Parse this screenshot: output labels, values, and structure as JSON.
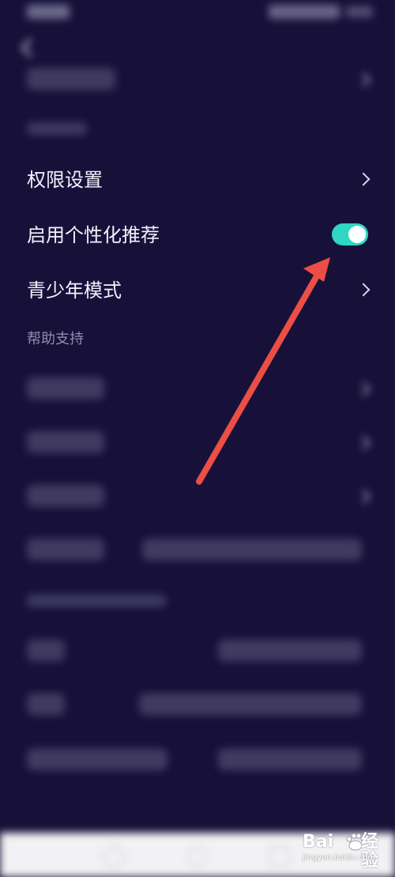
{
  "settings": {
    "privacy_items": [
      {
        "label": "权限设置"
      },
      {
        "label": "启用个性化推荐",
        "toggle_on": true
      },
      {
        "label": "青少年模式"
      }
    ],
    "help_section_title": "帮助支持"
  },
  "colors": {
    "background": "#17113a",
    "toggle_on": "#2fd6c4",
    "annotation_arrow": "#ec4e46",
    "nav_bar": "#f2f2f4"
  },
  "icons": {
    "back": "chevron-left-icon",
    "row_more": "chevron-right-icon",
    "toggle": "switch-icon"
  },
  "watermark": {
    "brand": "Bai",
    "suffix": "经验",
    "url": "jingyan.baidu.com"
  }
}
